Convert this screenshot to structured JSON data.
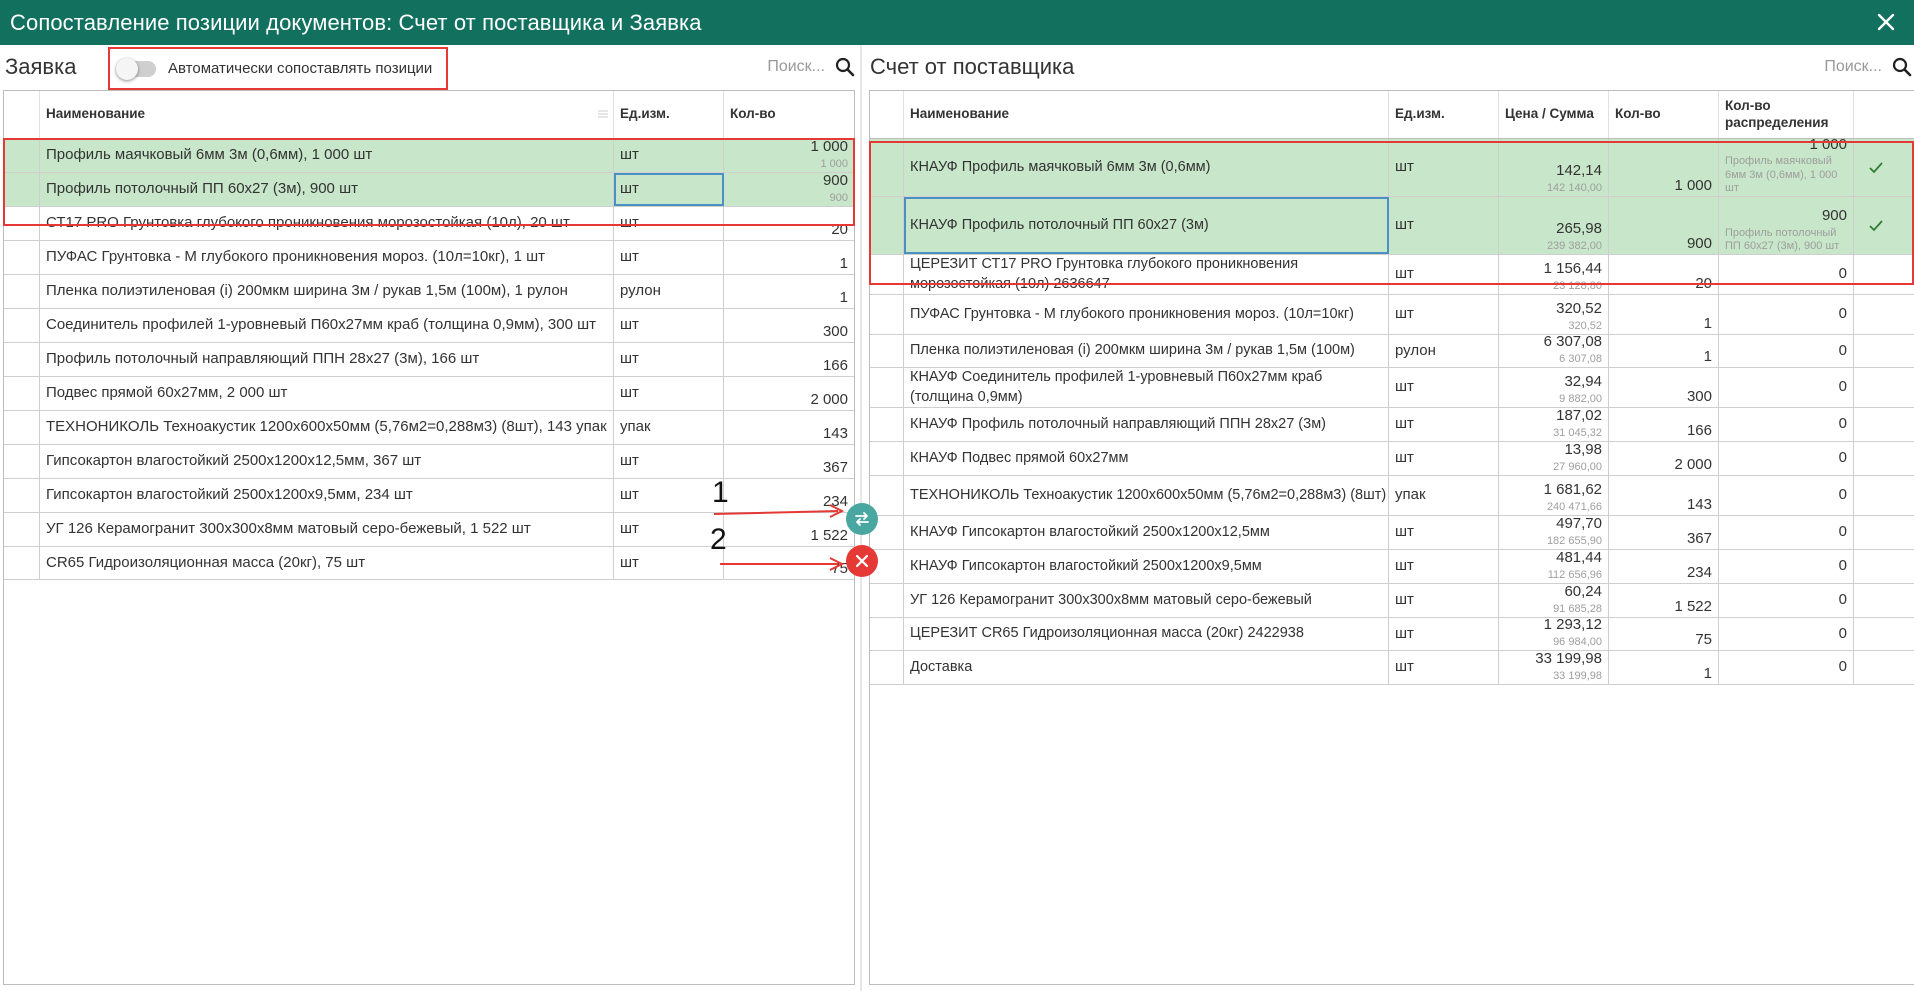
{
  "window": {
    "title": "Сопоставление позиции документов: Счет от поставщика и Заявка"
  },
  "left": {
    "title": "Заявка",
    "toggle_label": "Автоматически сопоставлять позиции",
    "search_placeholder": "Поиск...",
    "columns": {
      "name": "Наименование",
      "unit": "Ед.изм.",
      "qty": "Кол-во"
    },
    "rows": [
      {
        "name": "Профиль маячковый 6мм 3м (0,6мм), 1 000 шт",
        "unit": "шт",
        "qty": "1 000",
        "qty_sub": "1 000",
        "selected": true
      },
      {
        "name": "Профиль потолочный ПП 60х27 (3м), 900 шт",
        "unit": "шт",
        "qty": "900",
        "qty_sub": "900",
        "selected": true
      },
      {
        "name": "СТ17 PRO Грунтовка глубокого проникновения морозостойкая (10л), 20 шт",
        "unit": "шт",
        "qty": "20",
        "qty_sub": ""
      },
      {
        "name": "ПУФАС Грунтовка - М глубокого проникновения мороз. (10л=10кг), 1 шт",
        "unit": "шт",
        "qty": "1",
        "qty_sub": ""
      },
      {
        "name": "Пленка полиэтиленовая (i) 200мкм ширина 3м / рукав 1,5м (100м), 1 рулон",
        "unit": "рулон",
        "qty": "1",
        "qty_sub": ""
      },
      {
        "name": "Соединитель профилей 1-уровневый П60х27мм краб (толщина 0,9мм), 300 шт",
        "unit": "шт",
        "qty": "300",
        "qty_sub": ""
      },
      {
        "name": "Профиль потолочный направляющий ППН 28х27 (3м), 166 шт",
        "unit": "шт",
        "qty": "166",
        "qty_sub": ""
      },
      {
        "name": "Подвес прямой 60х27мм, 2 000 шт",
        "unit": "шт",
        "qty": "2 000",
        "qty_sub": ""
      },
      {
        "name": "ТЕХНОНИКОЛЬ Техноакустик 1200х600х50мм (5,76м2=0,288м3) (8шт), 143 упак",
        "unit": "упак",
        "qty": "143",
        "qty_sub": ""
      },
      {
        "name": "Гипсокартон влагостойкий 2500х1200х12,5мм, 367 шт",
        "unit": "шт",
        "qty": "367",
        "qty_sub": ""
      },
      {
        "name": "Гипсокартон влагостойкий 2500х1200х9,5мм, 234 шт",
        "unit": "шт",
        "qty": "234",
        "qty_sub": ""
      },
      {
        "name": "УГ 126 Керамогранит 300х300х8мм матовый серо-бежевый, 1 522 шт",
        "unit": "шт",
        "qty": "1 522",
        "qty_sub": ""
      },
      {
        "name": "CR65 Гидроизоляционная масса (20кг), 75 шт",
        "unit": "шт",
        "qty": "75",
        "qty_sub": ""
      }
    ]
  },
  "right": {
    "title": "Счет от поставщика",
    "search_placeholder": "Поиск...",
    "columns": {
      "name": "Наименование",
      "unit": "Ед.изм.",
      "price": "Цена / Сумма",
      "qty": "Кол-во",
      "dist": "Кол-во распределения"
    },
    "rows": [
      {
        "name": "КНАУФ Профиль маячковый 6мм 3м (0,6мм)",
        "unit": "шт",
        "price": "142,14",
        "sum": "142 140,00",
        "qty": "1 000",
        "dist": "1 000",
        "dist_sub": "Профиль маячковый 6мм 3м (0,6мм), 1 000 шт",
        "selected": true,
        "checked": true
      },
      {
        "name": "КНАУФ Профиль потолочный ПП 60х27 (3м)",
        "unit": "шт",
        "price": "265,98",
        "sum": "239 382,00",
        "qty": "900",
        "dist": "900",
        "dist_sub": "Профиль потолочный ПП 60х27 (3м), 900 шт",
        "selected": true,
        "checked": true
      },
      {
        "name": "ЦЕРЕЗИТ СТ17 PRO Грунтовка глубокого проникновения морозостойкая (10л) 2636647",
        "unit": "шт",
        "price": "1 156,44",
        "sum": "23 128,80",
        "qty": "20",
        "dist": "0",
        "dist_sub": ""
      },
      {
        "name": "ПУФАС Грунтовка - М глубокого проникновения мороз. (10л=10кг)",
        "unit": "шт",
        "price": "320,52",
        "sum": "320,52",
        "qty": "1",
        "dist": "0",
        "dist_sub": ""
      },
      {
        "name": "Пленка полиэтиленовая (i) 200мкм ширина 3м / рукав 1,5м (100м)",
        "unit": "рулон",
        "price": "6 307,08",
        "sum": "6 307,08",
        "qty": "1",
        "dist": "0",
        "dist_sub": ""
      },
      {
        "name": "КНАУФ Соединитель профилей 1-уровневый П60х27мм краб (толщина 0,9мм)",
        "unit": "шт",
        "price": "32,94",
        "sum": "9 882,00",
        "qty": "300",
        "dist": "0",
        "dist_sub": ""
      },
      {
        "name": "КНАУФ Профиль потолочный направляющий ППН 28х27 (3м)",
        "unit": "шт",
        "price": "187,02",
        "sum": "31 045,32",
        "qty": "166",
        "dist": "0",
        "dist_sub": ""
      },
      {
        "name": "КНАУФ Подвес прямой 60х27мм",
        "unit": "шт",
        "price": "13,98",
        "sum": "27 960,00",
        "qty": "2 000",
        "dist": "0",
        "dist_sub": ""
      },
      {
        "name": "ТЕХНОНИКОЛЬ Техноакустик 1200х600х50мм (5,76м2=0,288м3) (8шт)",
        "unit": "упак",
        "price": "1 681,62",
        "sum": "240 471,66",
        "qty": "143",
        "dist": "0",
        "dist_sub": ""
      },
      {
        "name": "КНАУФ Гипсокартон влагостойкий 2500х1200х12,5мм",
        "unit": "шт",
        "price": "497,70",
        "sum": "182 655,90",
        "qty": "367",
        "dist": "0",
        "dist_sub": ""
      },
      {
        "name": "КНАУФ Гипсокартон влагостойкий 2500х1200х9,5мм",
        "unit": "шт",
        "price": "481,44",
        "sum": "112 656,96",
        "qty": "234",
        "dist": "0",
        "dist_sub": ""
      },
      {
        "name": "УГ 126 Керамогранит 300х300х8мм матовый серо-бежевый",
        "unit": "шт",
        "price": "60,24",
        "sum": "91 685,28",
        "qty": "1 522",
        "dist": "0",
        "dist_sub": ""
      },
      {
        "name": "ЦЕРЕЗИТ CR65 Гидроизоляционная масса (20кг) 2422938",
        "unit": "шт",
        "price": "1 293,12",
        "sum": "96 984,00",
        "qty": "75",
        "dist": "0",
        "dist_sub": ""
      },
      {
        "name": "Доставка",
        "unit": "шт",
        "price": "33 199,98",
        "sum": "33 199,98",
        "qty": "1",
        "dist": "0",
        "dist_sub": ""
      }
    ]
  },
  "actions": {
    "match_icon": "swap-icon",
    "unmatch_icon": "close-icon",
    "annotation_1": "1",
    "annotation_2": "2"
  },
  "colors": {
    "titlebar": "#11705e",
    "selected_row": "#c8e6c9",
    "highlight_border": "#e53935",
    "match_button": "#4aa6a0",
    "unmatch_button": "#e53935"
  }
}
